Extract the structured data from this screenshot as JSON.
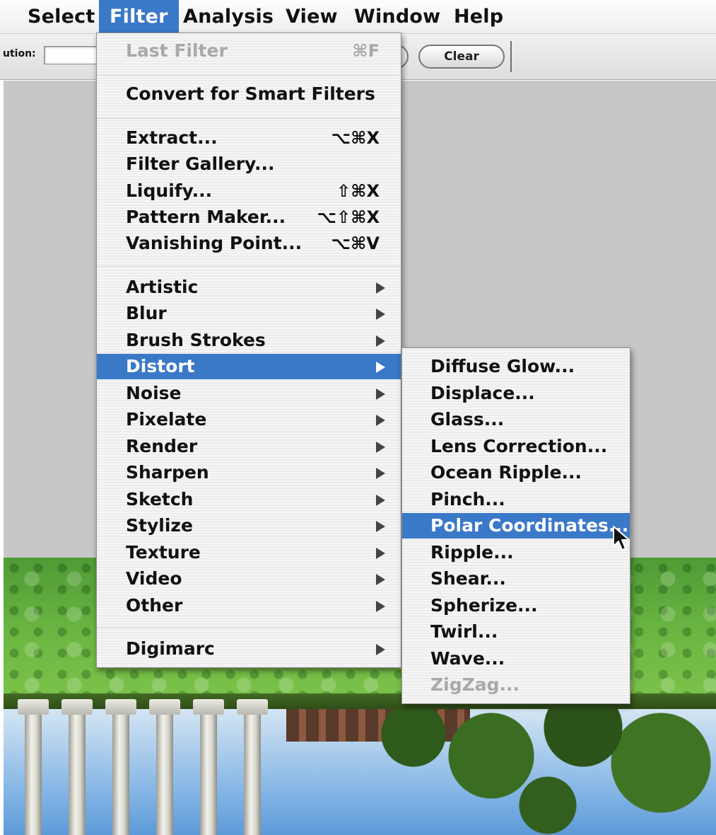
{
  "menubar": {
    "items": [
      {
        "label": "Select"
      },
      {
        "label": "Filter"
      },
      {
        "label": "Analysis"
      },
      {
        "label": "View"
      },
      {
        "label": "Window"
      },
      {
        "label": "Help"
      }
    ],
    "active": "Filter"
  },
  "options_bar": {
    "resolution_label": "ution:",
    "resolution_value": "",
    "clear_label": "Clear"
  },
  "filter_menu": {
    "last_filter": {
      "label": "Last Filter",
      "shortcut": "⌘F"
    },
    "convert_smart": {
      "label": "Convert for Smart Filters"
    },
    "extract": {
      "label": "Extract...",
      "shortcut": "⌥⌘X"
    },
    "filter_gallery": {
      "label": "Filter Gallery..."
    },
    "liquify": {
      "label": "Liquify...",
      "shortcut": "⇧⌘X"
    },
    "pattern_maker": {
      "label": "Pattern Maker...",
      "shortcut": "⌥⇧⌘X"
    },
    "vanishing_point": {
      "label": "Vanishing Point...",
      "shortcut": "⌥⌘V"
    },
    "artistic": {
      "label": "Artistic"
    },
    "blur": {
      "label": "Blur"
    },
    "brush_strokes": {
      "label": "Brush Strokes"
    },
    "distort": {
      "label": "Distort"
    },
    "noise": {
      "label": "Noise"
    },
    "pixelate": {
      "label": "Pixelate"
    },
    "render": {
      "label": "Render"
    },
    "sharpen": {
      "label": "Sharpen"
    },
    "sketch": {
      "label": "Sketch"
    },
    "stylize": {
      "label": "Stylize"
    },
    "texture": {
      "label": "Texture"
    },
    "video": {
      "label": "Video"
    },
    "other": {
      "label": "Other"
    },
    "digimarc": {
      "label": "Digimarc"
    }
  },
  "distort_submenu": {
    "diffuse_glow": "Diffuse Glow...",
    "displace": "Displace...",
    "glass": "Glass...",
    "lens_correction": "Lens Correction...",
    "ocean_ripple": "Ocean Ripple...",
    "pinch": "Pinch...",
    "polar_coordinates": "Polar Coordinates...",
    "ripple": "Ripple...",
    "shear": "Shear...",
    "spherize": "Spherize...",
    "twirl": "Twirl...",
    "wave": "Wave...",
    "zigzag": "ZigZag..."
  },
  "colors": {
    "highlight": "#3a78c8",
    "disabled_text": "#a9a9a9",
    "workspace_gray": "#c7c7c7"
  }
}
